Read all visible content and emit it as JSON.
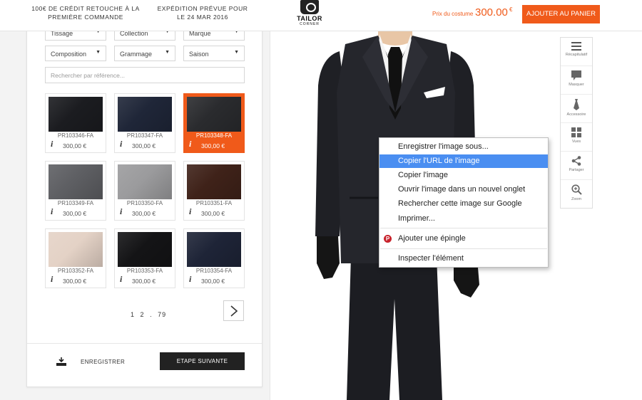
{
  "header": {
    "promo1": "100€ DE CRÉDIT RETOUCHE À LA PREMIÈRE COMMANDE",
    "promo2": "EXPÉDITION PRÉVUE POUR LE 24 MAR 2016",
    "logo_text": "TAILOR",
    "logo_sub": "CORNER",
    "price_label": "Prix du costume",
    "price_value": "300.00",
    "price_currency": "€",
    "cart_button": "AJOUTER AU PANIER"
  },
  "filters": {
    "row1": [
      "Tissage",
      "Collection",
      "Marque"
    ],
    "row2": [
      "Composition",
      "Grammage",
      "Saison"
    ],
    "search_placeholder": "Rechercher par référence..."
  },
  "fabrics": [
    {
      "code": "PR103346-FA",
      "price": "300,00 €",
      "color": "#1b1c20",
      "active": false
    },
    {
      "code": "PR103347-FA",
      "price": "300,00 €",
      "color": "#1f2638",
      "active": false
    },
    {
      "code": "PR103348-FA",
      "price": "300,00 €",
      "color": "#2a2b2e",
      "active": true
    },
    {
      "code": "PR103349-FA",
      "price": "300,00 €",
      "color": "#5e5f63",
      "active": false
    },
    {
      "code": "PR103350-FA",
      "price": "300,00 €",
      "color": "#9b9b9d",
      "active": false
    },
    {
      "code": "PR103351-FA",
      "price": "300,00 €",
      "color": "#3f2219",
      "active": false
    },
    {
      "code": "PR103352-FA",
      "price": "300,00 €",
      "color": "#e4d2c6",
      "active": false
    },
    {
      "code": "PR103353-FA",
      "price": "300,00 €",
      "color": "#141416",
      "active": false
    },
    {
      "code": "PR103354-FA",
      "price": "300,00 €",
      "color": "#1e2437",
      "active": false
    }
  ],
  "info_glyph": "i",
  "pagination": {
    "items": [
      "1",
      "2",
      ".",
      "79"
    ]
  },
  "footer": {
    "save_label": "ENREGISTRER",
    "next_label": "ETAPE SUIVANTE"
  },
  "toolbar": [
    {
      "label": "Récapitulatif",
      "icon": "menu-icon"
    },
    {
      "label": "Masquer",
      "icon": "speech-icon"
    },
    {
      "label": "Accessoire",
      "icon": "tie-icon"
    },
    {
      "label": "Vues",
      "icon": "grid-icon"
    },
    {
      "label": "Partager",
      "icon": "share-icon"
    },
    {
      "label": "Zoom",
      "icon": "zoom-icon"
    }
  ],
  "context_menu": [
    "Enregistrer l'image sous...",
    "Copier l'URL de l'image",
    "Copier l'image",
    "Ouvrir l'image dans un nouvel onglet",
    "Rechercher cette image sur Google",
    "Imprimer...",
    "Ajouter une épingle",
    "Inspecter l'élément"
  ],
  "colors": {
    "accent": "#f05a1a",
    "menu_highlight": "#4a8ef1",
    "dark_button": "#222222"
  }
}
